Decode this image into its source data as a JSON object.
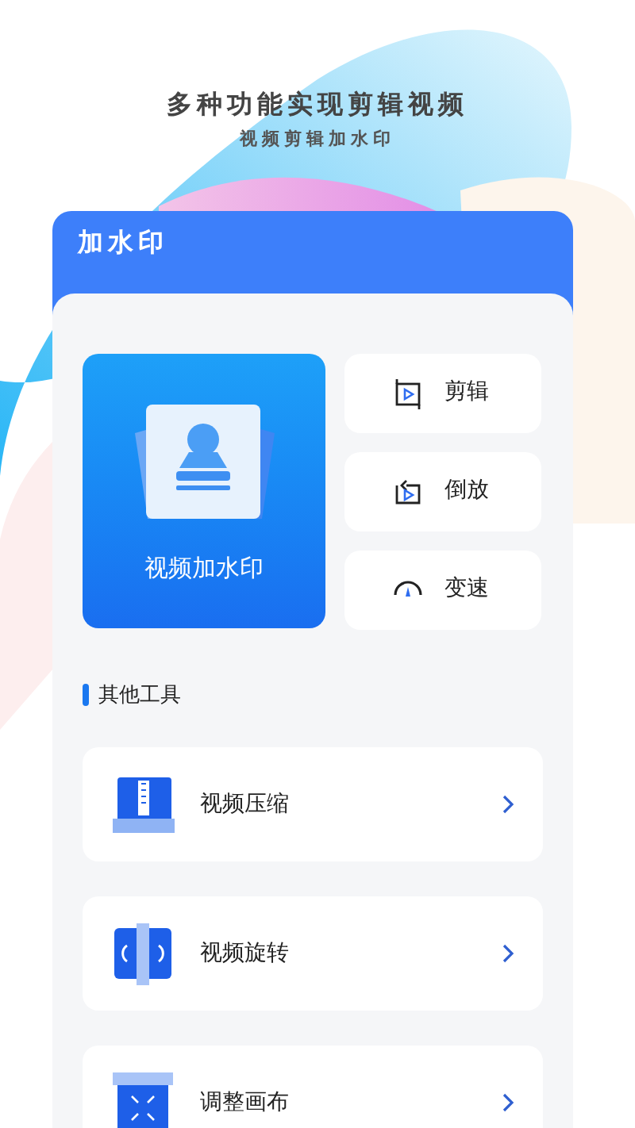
{
  "headline": "多种功能实现剪辑视频",
  "subtitle": "视频剪辑加水印",
  "panel_title": "加水印",
  "main_tool": {
    "label": "视频加水印"
  },
  "quick_tools": [
    {
      "kind": "trim",
      "label": "剪辑"
    },
    {
      "kind": "reverse",
      "label": "倒放"
    },
    {
      "kind": "speed",
      "label": "变速"
    }
  ],
  "section_title": "其他工具",
  "other_tools": [
    {
      "kind": "compress",
      "label": "视频压缩"
    },
    {
      "kind": "rotate",
      "label": "视频旋转"
    },
    {
      "kind": "canvas",
      "label": "调整画布"
    }
  ]
}
